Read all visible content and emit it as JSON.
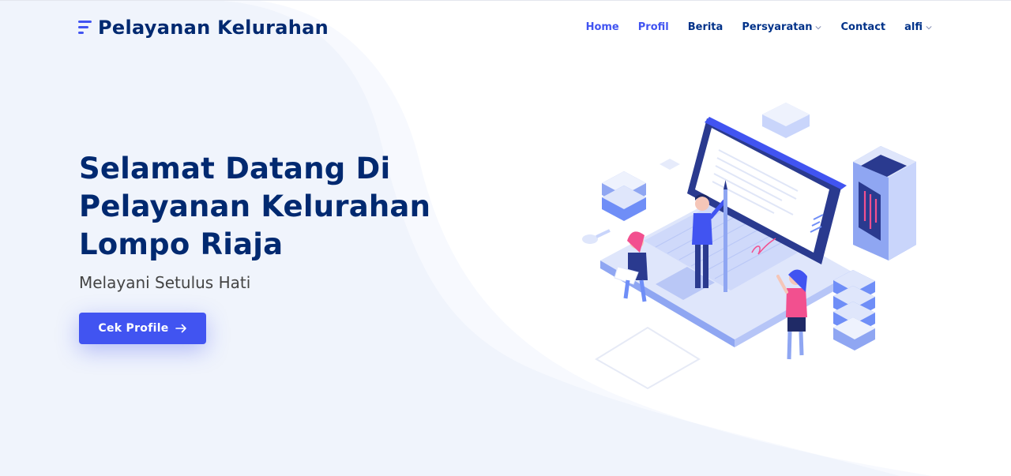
{
  "brand": {
    "name": "Pelayanan Kelurahan",
    "accent": "#4154f1",
    "heading_color": "#012970",
    "icon": "list-lines-icon"
  },
  "nav": {
    "items": [
      {
        "label": "Home",
        "state": "active"
      },
      {
        "label": "Profil",
        "state": "highlight"
      },
      {
        "label": "Berita",
        "state": "default"
      },
      {
        "label": "Persyaratan",
        "state": "dropdown",
        "icon": "chevron-down-icon"
      },
      {
        "label": "Contact",
        "state": "default"
      },
      {
        "label": "alfi",
        "state": "dropdown",
        "icon": "chevron-down-icon"
      }
    ]
  },
  "hero": {
    "title_lines": [
      "Selamat Datang Di",
      "Pelayanan Kelurahan",
      "Lompo Riaja"
    ],
    "tagline": "Melayani Setulus Hati",
    "cta_label": "Cek Profile",
    "cta_icon": "arrow-right-icon"
  },
  "illustration": {
    "icon": "laptop-teamwork-illustration",
    "colors": {
      "dark": "#2a3a8f",
      "mid": "#6f8ef7",
      "light": "#c9d5fb",
      "pale": "#e9eefc",
      "pink": "#f2508f"
    }
  }
}
